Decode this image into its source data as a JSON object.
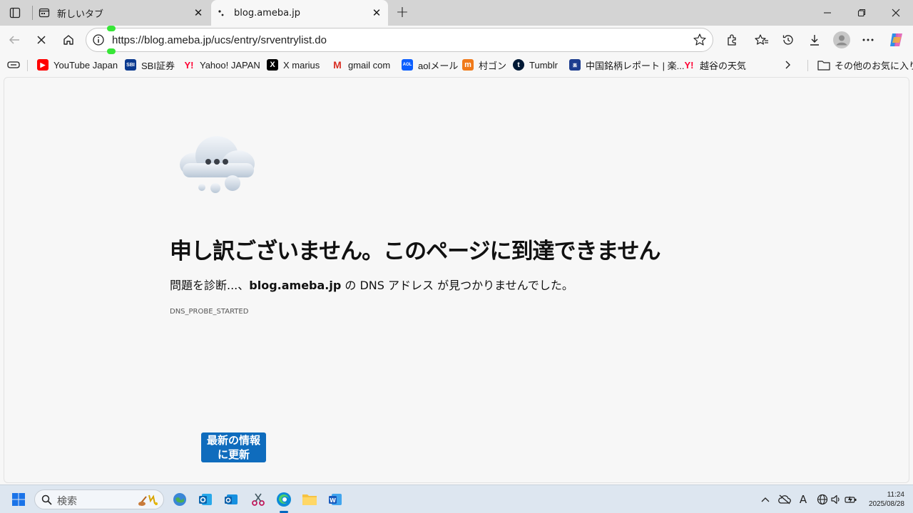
{
  "tabs": [
    {
      "title": "新しいタブ",
      "active": false
    },
    {
      "title": "blog.ameba.jp",
      "active": true
    }
  ],
  "address_bar": {
    "url": "https://blog.ameba.jp/ucs/entry/srventrylist.do"
  },
  "bookmarks": [
    {
      "label": "YouTube Japan",
      "icon": "youtube-icon"
    },
    {
      "label": "SBI証券",
      "icon": "sbi-icon"
    },
    {
      "label": "Yahoo! JAPAN",
      "icon": "yahoo-icon"
    },
    {
      "label": "X marius",
      "icon": "x-icon"
    },
    {
      "label": "gmail com",
      "icon": "gmail-icon"
    },
    {
      "label": "aolメール",
      "icon": "aol-icon"
    },
    {
      "label": "村ゴン",
      "icon": "murago-icon"
    },
    {
      "label": "Tumblr",
      "icon": "tumblr-icon"
    },
    {
      "label": "中国銘柄レポート | 楽...",
      "icon": "rakuten-icon"
    },
    {
      "label": "越谷の天気",
      "icon": "yahoo-icon"
    }
  ],
  "other_bookmarks": "その他のお気に入り",
  "error": {
    "title": "申し訳ございません。このページに到達できません",
    "sub_prefix": "問題を診断...、",
    "sub_host": "blog.ameba.jp",
    "sub_suffix": " の DNS アドレス が見つかりませんでした。",
    "code": "DNS_PROBE_STARTED",
    "refresh_line1": "最新の情報",
    "refresh_line2": "に更新"
  },
  "taskbar": {
    "search_placeholder": "検索",
    "time": "11:24",
    "date": "2025/08/28",
    "ime": "A"
  }
}
